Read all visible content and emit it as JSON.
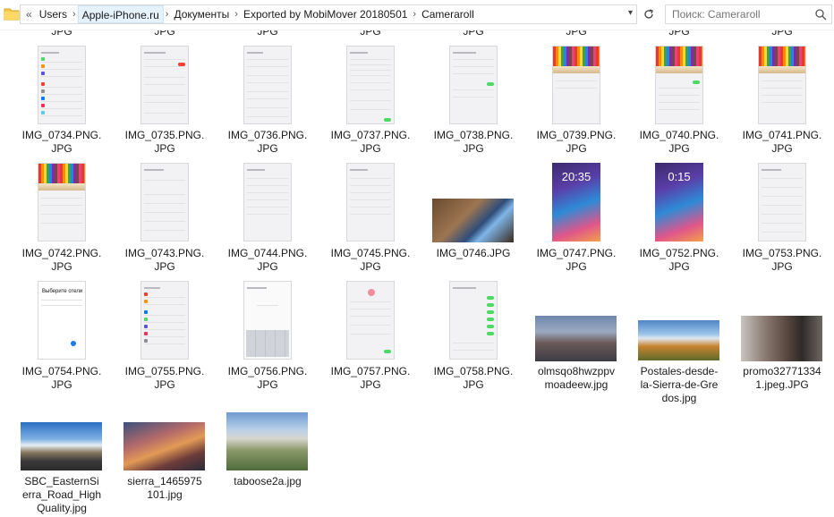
{
  "breadcrumb": {
    "overflow": "«",
    "items": [
      "Users",
      "Apple-iPhone.ru",
      "Документы",
      "Exported by MobiMover 20180501",
      "Cameraroll"
    ]
  },
  "search": {
    "placeholder": "Поиск: Cameraroll"
  },
  "icons": {
    "folder": "folder-icon",
    "refresh": "refresh-icon",
    "search": "search-icon",
    "dropdown": "chevron-down-icon"
  },
  "partial_labels": [
    "JPG",
    "JPG",
    "JPG",
    "JPG",
    "JPG",
    "JPG",
    "JPG",
    "JPG"
  ],
  "files": [
    "IMG_0734.PNG.\nJPG",
    "IMG_0735.PNG.\nJPG",
    "IMG_0736.PNG.\nJPG",
    "IMG_0737.PNG.\nJPG",
    "IMG_0738.PNG.\nJPG",
    "IMG_0739.PNG.\nJPG",
    "IMG_0740.PNG.\nJPG",
    "IMG_0741.PNG.\nJPG",
    "IMG_0742.PNG.\nJPG",
    "IMG_0743.PNG.\nJPG",
    "IMG_0744.PNG.\nJPG",
    "IMG_0745.PNG.\nJPG",
    "IMG_0746.JPG",
    "IMG_0747.PNG.\nJPG",
    "IMG_0752.PNG.\nJPG",
    "IMG_0753.PNG.\nJPG",
    "IMG_0754.PNG.\nJPG",
    "IMG_0755.PNG.\nJPG",
    "IMG_0756.PNG.\nJPG",
    "IMG_0757.PNG.\nJPG",
    "IMG_0758.PNG.\nJPG",
    "olmsqo8hwzppv\nmoadeew.jpg",
    "Postales-desde-\nla-Sierra-de-Gre\ndos.jpg",
    "promo32771334\n1.jpeg.JPG",
    "SBC_EasternSi\nerra_Road_High\nQuality.jpg",
    "sierra_1465975\n101.jpg",
    "taboose2a.jpg"
  ],
  "lock_times": [
    "20:35",
    "0:15"
  ],
  "thumb_text": {
    "choose_language": "Выберите отели"
  }
}
